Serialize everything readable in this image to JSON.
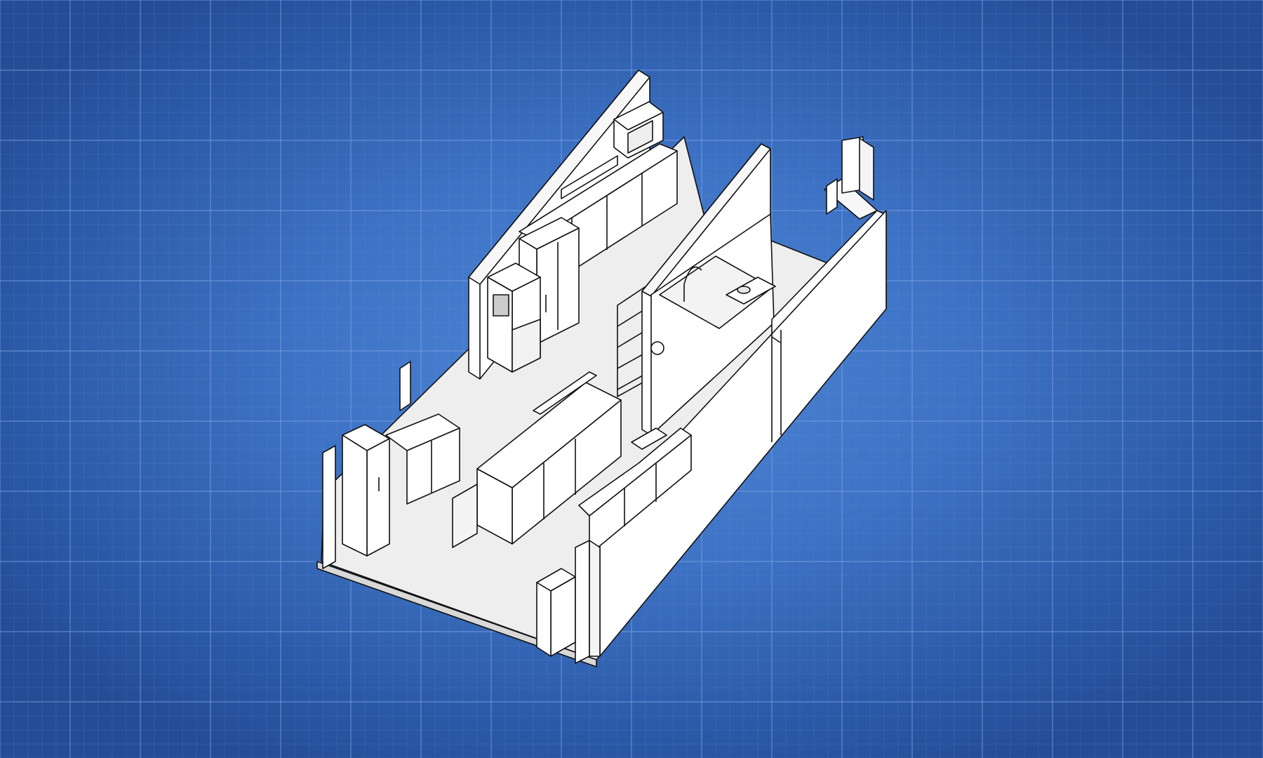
{
  "scene": {
    "background_color": "#3f74c6",
    "grid_color": "#7ea6e6",
    "line_color": "#111111",
    "fill_color": "#ffffff",
    "floor_color": "#ececec"
  },
  "drawing": {
    "subject": "isometric-kitchen-floor-plan",
    "equipment": [
      "microwave-icon",
      "ice-machine-icon",
      "reach-in-refrigerator-icon",
      "undercounter-refrigerator-icon",
      "prep-table-icon",
      "wire-shelving-icon",
      "fire-extinguisher-icon",
      "hand-sink-icon",
      "three-compartment-sink-icon",
      "cooking-range-icon",
      "water-heater-icon",
      "door-icon"
    ]
  }
}
